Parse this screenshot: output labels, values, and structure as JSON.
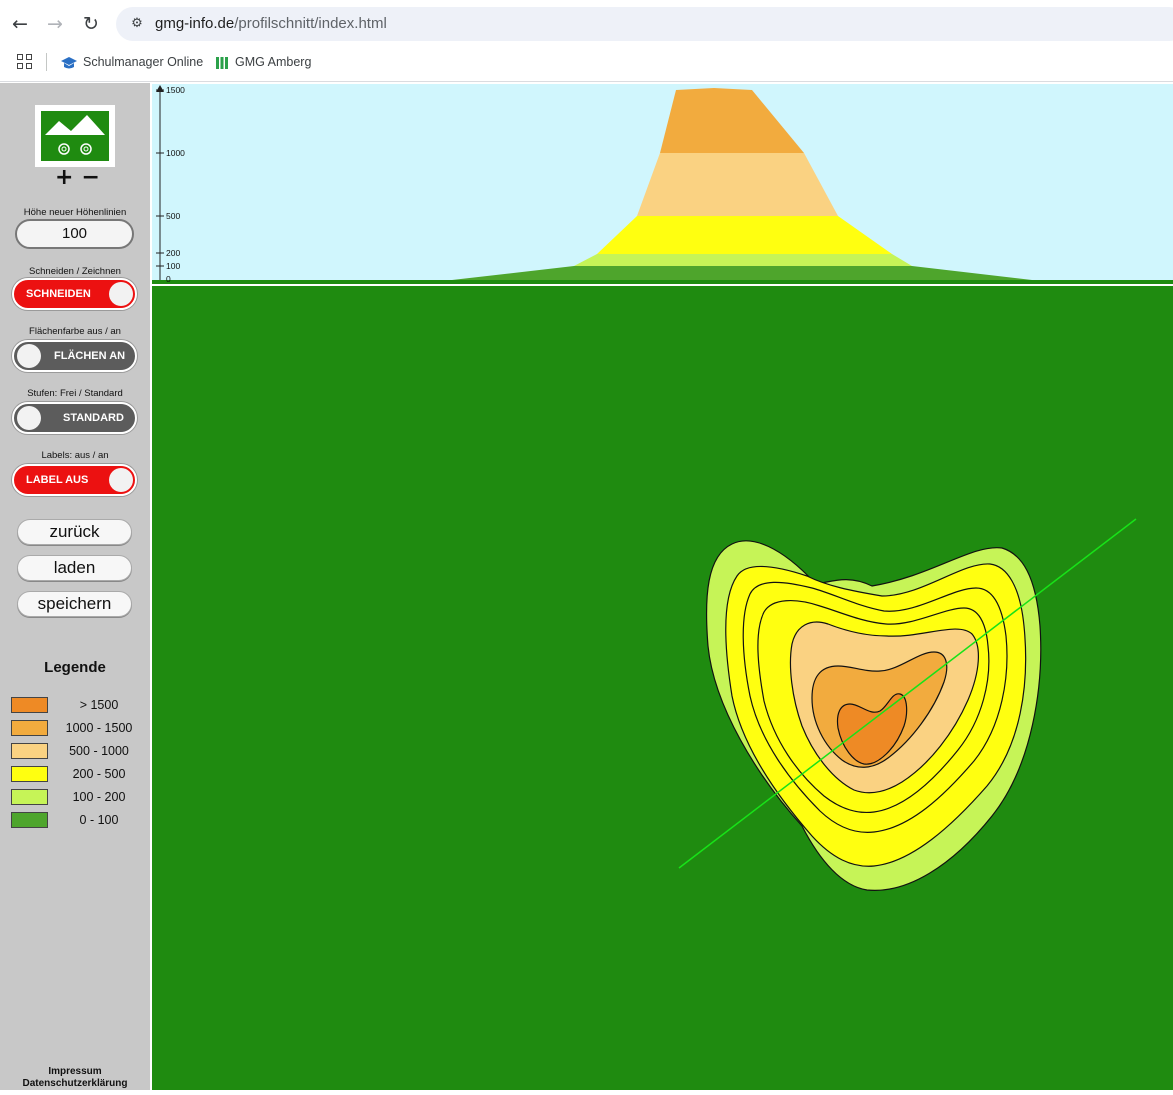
{
  "browser": {
    "url_host": "gmg-info.de",
    "url_path": "/profilschnitt/index.html",
    "icons": {
      "back": "arrow-left-icon",
      "forward": "arrow-right-icon",
      "reload": "reload-icon",
      "site_info": "tune-icon"
    },
    "bookmarks": [
      {
        "label": "Schulmanager Online",
        "icon": "graduation-cap-icon"
      },
      {
        "label": "GMG Amberg",
        "icon": "bars-icon"
      }
    ]
  },
  "sidebar": {
    "zoom_in": "+",
    "zoom_out": "−",
    "height_label": "Höhe neuer Höhenlinien",
    "height_value": "100",
    "cut_draw_label": "Schneiden / Zeichnen",
    "cut_draw_toggle": "SCHNEIDEN",
    "area_label": "Flächenfarbe aus / an",
    "area_toggle": "FLÄCHEN AN",
    "steps_label": "Stufen: Frei / Standard",
    "steps_toggle": "STANDARD",
    "labels_label": "Labels: aus / an",
    "labels_toggle": "LABEL AUS",
    "btn_back": "zurück",
    "btn_load": "laden",
    "btn_save": "speichern",
    "legend_title": "Legende",
    "legend": [
      {
        "label": "> 1500",
        "color": "#ee8a25"
      },
      {
        "label": "1000 - 1500",
        "color": "#f2ab3e"
      },
      {
        "label": "500 - 1000",
        "color": "#fad282"
      },
      {
        "label": "200 - 500",
        "color": "#ffff10"
      },
      {
        "label": "100 - 200",
        "color": "#c6f457"
      },
      {
        "label": "0 - 100",
        "color": "#4ea52c"
      }
    ],
    "imprint": "Impressum",
    "privacy": "Datenschutzerklärung"
  },
  "profile": {
    "axis_ticks": [
      "1500",
      "1000",
      "500",
      "200",
      "100",
      "0"
    ],
    "sky_color": "#d0f6fd"
  },
  "map": {
    "ground_color": "#1f8b10",
    "cut_line_color": "#18e218"
  }
}
